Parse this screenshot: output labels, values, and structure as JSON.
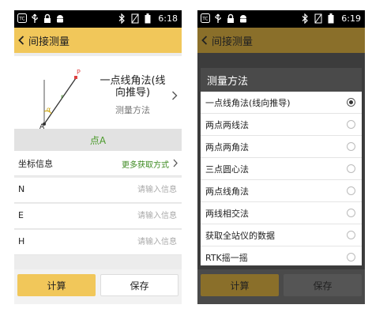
{
  "status_bar": {
    "left": {
      "time": "6:18"
    },
    "right": {
      "time": "6:19"
    },
    "badge_text": "TC"
  },
  "left_screen": {
    "title": "间接测量",
    "method": {
      "name": "一点线角法(线向推导)",
      "subtitle": "测量方法"
    },
    "diagram_labels": {
      "p": "P",
      "r": "r",
      "alpha": "α",
      "a": "A"
    },
    "point_header": "点A",
    "coord_info": {
      "label": "坐标信息",
      "more": "更多获取方式"
    },
    "fields": [
      {
        "label": "N",
        "value": "",
        "placeholder": "请输入信息"
      },
      {
        "label": "E",
        "value": "",
        "placeholder": "请输入信息"
      },
      {
        "label": "H",
        "value": "",
        "placeholder": "请输入信息"
      }
    ],
    "buttons": {
      "calc": "计算",
      "save": "保存"
    }
  },
  "right_screen": {
    "title": "间接测量",
    "dialog": {
      "title": "测量方法",
      "options": [
        {
          "label": "一点线角法(线向推导)",
          "selected": true
        },
        {
          "label": "两点两线法",
          "selected": false
        },
        {
          "label": "两点两角法",
          "selected": false
        },
        {
          "label": "三点圆心法",
          "selected": false
        },
        {
          "label": "两点线角法",
          "selected": false
        },
        {
          "label": "两线相交法",
          "selected": false
        },
        {
          "label": "获取全站仪的数据",
          "selected": false
        },
        {
          "label": "RTK摇一摇",
          "selected": false
        }
      ]
    },
    "buttons": {
      "calc": "计算",
      "save": "保存"
    }
  },
  "colors": {
    "accent": "#f1c75a",
    "accent_dim": "#8a6f2a",
    "green_text": "#4a9a2a",
    "diagram_line": "#333333",
    "diagram_point": "#e04040",
    "diagram_alpha": "#c8a000"
  }
}
